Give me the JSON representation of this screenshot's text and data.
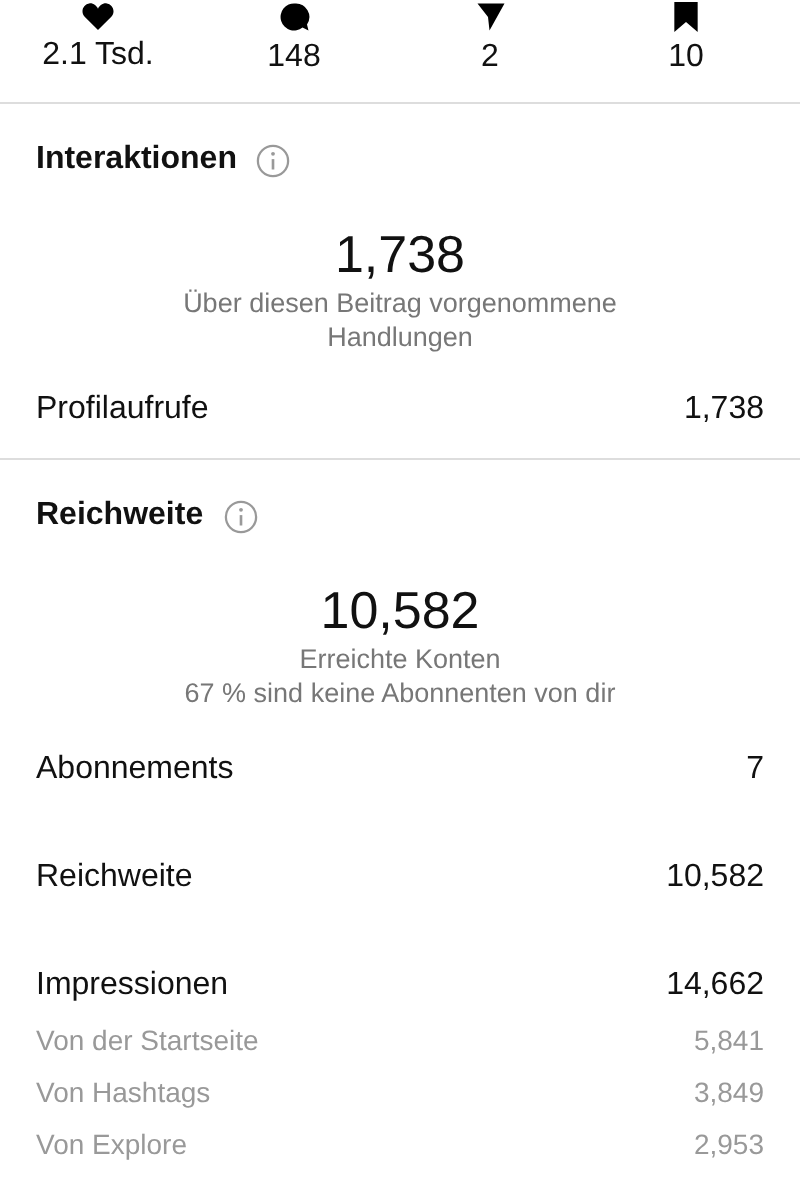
{
  "stats": [
    {
      "kind": "likes",
      "value": "2.1 Tsd."
    },
    {
      "kind": "comments",
      "value": "148"
    },
    {
      "kind": "shares",
      "value": "2"
    },
    {
      "kind": "saves",
      "value": "10"
    }
  ],
  "sections": [
    {
      "title": "Interaktionen",
      "big": "1,738",
      "caption": [
        "Über diesen Beitrag vorgenommene Handlungen"
      ],
      "rows": [
        {
          "kind": "main",
          "label": "Profilaufrufe",
          "value": "1,738"
        }
      ]
    },
    {
      "title": "Reichweite",
      "big": "10,582",
      "caption": [
        "Erreichte Konten",
        "67 % sind keine Abonnenten von dir"
      ],
      "rows": [
        {
          "kind": "main",
          "label": "Abonnements",
          "value": "7"
        },
        {
          "kind": "main",
          "label": "Reichweite",
          "value": "10,582"
        },
        {
          "kind": "main",
          "label": "Impressionen",
          "value": "14,662"
        },
        {
          "kind": "sub",
          "label": "Von der Startseite",
          "value": "5,841"
        },
        {
          "kind": "sub",
          "label": "Von Hashtags",
          "value": "3,849"
        },
        {
          "kind": "sub",
          "label": "Von Explore",
          "value": "2,953"
        }
      ]
    }
  ]
}
